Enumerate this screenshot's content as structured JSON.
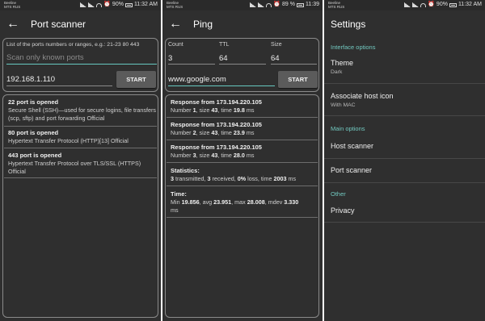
{
  "status_bars": [
    {
      "carrier_line1": "Beeline",
      "carrier_line2": "MTS RUS",
      "battery": "90%",
      "time": "11:32 AM"
    },
    {
      "carrier_line1": "Beeline",
      "carrier_line2": "MTS RUS",
      "battery": "89 %",
      "time": "11:39"
    },
    {
      "carrier_line1": "Beeline",
      "carrier_line2": "MTS RUS",
      "battery": "90%",
      "time": "11:32 AM"
    }
  ],
  "port_scanner": {
    "title": "Port scanner",
    "hint": "List of the ports numbers or ranges, e.g.: 21-23 80 443",
    "ports_placeholder": "Scan only known ports",
    "host_value": "192.168.1.110",
    "start_label": "START",
    "results": [
      {
        "title": "22 port is opened",
        "desc": "Secure Shell (SSH)—used for secure logins, file transfers (scp, sftp) and port forwarding Official"
      },
      {
        "title": "80 port is opened",
        "desc": "Hypertext Transfer Protocol (HTTP)[13]  Official"
      },
      {
        "title": "443 port is opened",
        "desc": "Hypertext Transfer Protocol over TLS/SSL (HTTPS) Official"
      }
    ]
  },
  "ping": {
    "title": "Ping",
    "count_label": "Count",
    "count_value": "3",
    "ttl_label": "TTL",
    "ttl_value": "64",
    "size_label": "Size",
    "size_value": "64",
    "host_value": "www.google.com",
    "start_label": "START",
    "responses": [
      {
        "title": "Response from 173.194.220.105",
        "number_label": "Number ",
        "number": "1",
        "size_label": ", size ",
        "size": "43",
        "time_label": ", time ",
        "time": "19.8",
        "unit": " ms"
      },
      {
        "title": "Response from 173.194.220.105",
        "number_label": "Number ",
        "number": "2",
        "size_label": ", size ",
        "size": "43",
        "time_label": ", time ",
        "time": "23.9",
        "unit": " ms"
      },
      {
        "title": "Response from 173.194.220.105",
        "number_label": "Number ",
        "number": "3",
        "size_label": ", size ",
        "size": "43",
        "time_label": ", time ",
        "time": "28.0",
        "unit": " ms"
      }
    ],
    "statistics": {
      "title": "Statistics:",
      "transmitted": "3",
      "transmitted_label": " transmitted, ",
      "received": "3",
      "received_label": " received, ",
      "loss": "0%",
      "loss_label": " loss, time ",
      "time": "2003",
      "unit": " ms"
    },
    "time_stats": {
      "title": "Time:",
      "min_label": "Min ",
      "min": "19.856",
      "avg_label": ", avg ",
      "avg": "23.951",
      "max_label": ", max ",
      "max": "28.008",
      "mdev_label": ", mdev ",
      "mdev": "3.330",
      "unit": "ms"
    }
  },
  "settings": {
    "title": "Settings",
    "interface_header": "Interface options",
    "theme_label": "Theme",
    "theme_value": "Dark",
    "host_icon_label": "Associate host icon",
    "host_icon_value": "With MAC",
    "main_header": "Main options",
    "host_scanner": "Host scanner",
    "port_scanner": "Port scanner",
    "other_header": "Other",
    "privacy": "Privacy"
  },
  "colors": {
    "background": "#2f2f2f",
    "accent": "#66c8c0",
    "button": "#5b5b5b"
  },
  "icons": {
    "back": "arrow-back-icon",
    "signal": "signal-icon",
    "wifi": "wifi-icon",
    "alarm": "alarm-icon",
    "battery": "battery-icon"
  }
}
